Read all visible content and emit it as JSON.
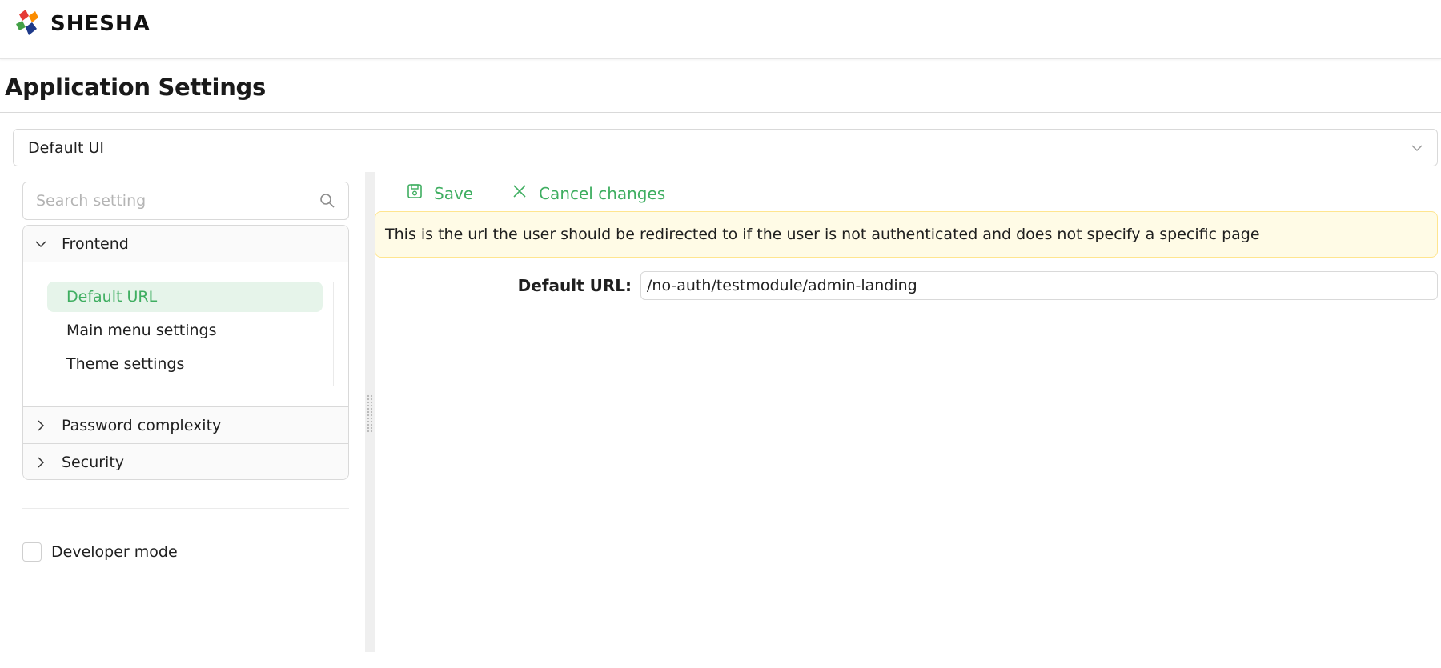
{
  "app": {
    "logo_text": "SHESHA",
    "page_title": "Application Settings"
  },
  "module_select": {
    "value": "Default UI"
  },
  "sidebar": {
    "search_placeholder": "Search setting",
    "groups": [
      {
        "label": "Frontend",
        "expanded": true,
        "items": [
          {
            "label": "Default URL",
            "active": true
          },
          {
            "label": "Main menu settings",
            "active": false
          },
          {
            "label": "Theme settings",
            "active": false
          }
        ]
      },
      {
        "label": "Password complexity",
        "expanded": false
      },
      {
        "label": "Security",
        "expanded": false
      }
    ],
    "developer_mode": {
      "label": "Developer mode",
      "checked": false
    }
  },
  "toolbar": {
    "save_label": "Save",
    "cancel_label": "Cancel changes"
  },
  "setting": {
    "description": "This is the url the user should be redirected to if the user is not authenticated and does not specify a specific page",
    "field_label": "Default URL",
    "field_value": "/no-auth/testmodule/admin-landing"
  },
  "colors": {
    "accent": "#3fae61",
    "active_bg": "#e6f4ea",
    "alert_bg": "#fffbe6",
    "alert_border": "#ffe58f"
  },
  "icons": {
    "logo": "shesha-logo-icon",
    "select_chevron": "chevron-down-icon",
    "search": "search-icon",
    "expanded": "chevron-down-icon",
    "collapsed": "chevron-right-icon",
    "save": "save-icon",
    "cancel": "close-icon"
  }
}
